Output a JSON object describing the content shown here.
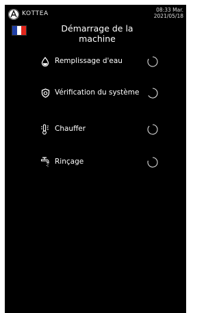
{
  "statusbar": {
    "brand": "KOTTEA",
    "time": "08:33 Mar.",
    "date": "2021/05/18"
  },
  "header": {
    "title": "Démarrage de la machine",
    "flag_colors": [
      "#1f3fa6",
      "#ffffff",
      "#e1251b"
    ]
  },
  "steps": [
    {
      "label": "Remplissage d'eau",
      "icon": "water-drop-icon",
      "status": "in-progress"
    },
    {
      "label": "Vérification du système",
      "icon": "shield-check-icon",
      "status": "in-progress"
    },
    {
      "label": "Chauffer",
      "icon": "thermometer-icon",
      "status": "in-progress"
    },
    {
      "label": "Rinçage",
      "icon": "faucet-icon",
      "status": "in-progress"
    }
  ],
  "colors": {
    "background": "#000000",
    "text": "#ffffff"
  }
}
